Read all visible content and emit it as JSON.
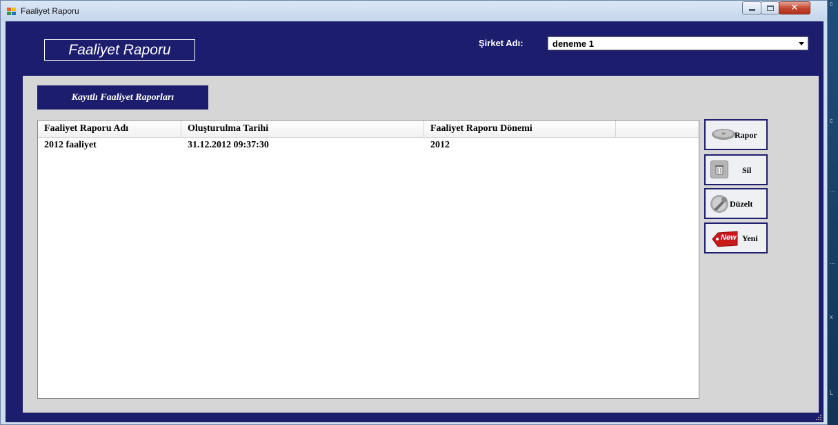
{
  "window": {
    "title": "Faaliyet Raporu"
  },
  "header": {
    "logo_text": "Faaliyet Raporu",
    "company_label": "Şirket Adı:",
    "company_value": "deneme 1"
  },
  "section": {
    "title": "Kayıtlı Faaliyet Raporları"
  },
  "table": {
    "columns": [
      "Faaliyet Raporu Adı",
      "Oluşturulma Tarihi",
      "Faaliyet Raporu Dönemi"
    ],
    "rows": [
      [
        "2012 faaliyet",
        "31.12.2012 09:37:30",
        "2012"
      ]
    ]
  },
  "actions": {
    "rapor": "Rapor",
    "sil": "Sil",
    "duzelt": "Düzelt",
    "yeni": "Yeni",
    "new_badge": "New"
  },
  "desktop_fragments": [
    "c",
    "c",
    "...",
    "...",
    "x",
    "L"
  ],
  "colors": {
    "frame": "#1d1d6e",
    "panel": "#d6d6d6",
    "close": "#c2442d"
  }
}
